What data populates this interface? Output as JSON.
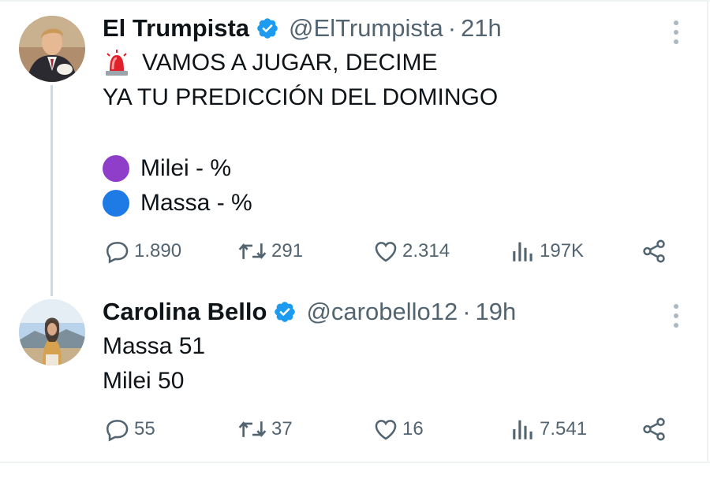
{
  "tweets": [
    {
      "display_name": "El Trumpista",
      "handle": "@ElTrumpista",
      "separator": "·",
      "time": "21h",
      "avatar": "avatar-man-in-suit",
      "lines": [
        {
          "emoji": "police-light-emoji",
          "text": "VAMOS A JUGAR, DECIME"
        },
        {
          "text": "YA TU PREDICCIÓN DEL DOMINGO"
        },
        {
          "emoji": "purple-circle-emoji",
          "text": "Milei - %"
        },
        {
          "emoji": "blue-circle-emoji",
          "text": "Massa - %"
        }
      ],
      "stats": {
        "replies": "1.890",
        "retweets": "291",
        "likes": "2.314",
        "views": "197K"
      }
    },
    {
      "display_name": "Carolina Bello",
      "handle": "@carobello12",
      "separator": "·",
      "time": "19h",
      "avatar": "avatar-woman-outdoors",
      "lines": [
        {
          "text": "Massa 51"
        },
        {
          "text": "Milei 50"
        }
      ],
      "stats": {
        "replies": "55",
        "retweets": "37",
        "likes": "16",
        "views": "7.541"
      }
    }
  ],
  "colors": {
    "text": "#0f1419",
    "secondary": "#536471",
    "verified": "#1d9bf0",
    "purple_circle": "#8e3ec9",
    "blue_circle": "#1e7be6",
    "siren_red": "#e0202a"
  }
}
